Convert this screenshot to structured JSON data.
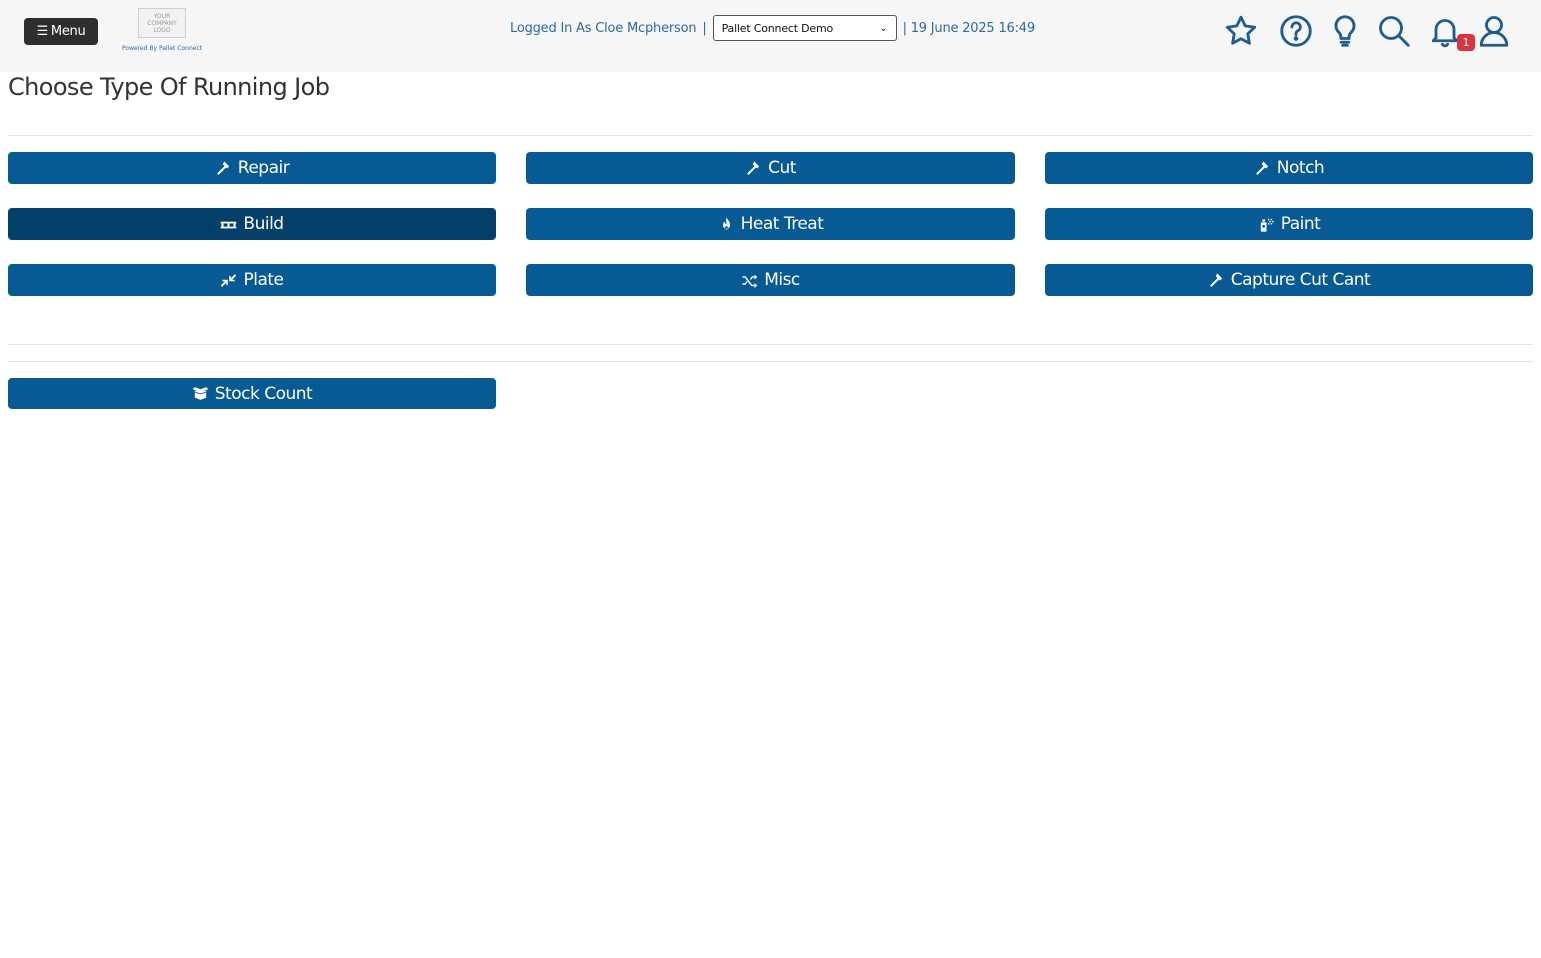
{
  "header": {
    "menu_label": "Menu",
    "logo_text": "YOUR COMPANY LOGO",
    "powered_by": "Powered By Pallet Connect",
    "logged_in_text": "Logged In As Cloe Mcpherson",
    "separator": "|",
    "org_selected": "Pallet Connect Demo",
    "datetime": "| 19 June 2025 16:49",
    "notification_count": "1",
    "icons": [
      "star-icon",
      "help-icon",
      "lightbulb-icon",
      "search-icon",
      "bell-icon",
      "user-icon"
    ]
  },
  "page": {
    "title": "Choose Type Of Running Job"
  },
  "jobs": [
    {
      "label": "Repair",
      "icon": "hammer-icon"
    },
    {
      "label": "Cut",
      "icon": "hammer-icon"
    },
    {
      "label": "Notch",
      "icon": "hammer-icon"
    },
    {
      "label": "Build",
      "icon": "pallet-icon",
      "active": true
    },
    {
      "label": "Heat Treat",
      "icon": "fire-icon"
    },
    {
      "label": "Paint",
      "icon": "spray-can-icon"
    },
    {
      "label": "Plate",
      "icon": "compress-icon"
    },
    {
      "label": "Misc",
      "icon": "shuffle-icon"
    },
    {
      "label": "Capture Cut Cant",
      "icon": "hammer-icon"
    }
  ],
  "stock": {
    "label": "Stock Count",
    "icon": "box-open-icon"
  },
  "colors": {
    "button": "#085a94",
    "button_active": "#05406a",
    "header_text": "#2d6aa0",
    "badge": "#d9343f"
  }
}
